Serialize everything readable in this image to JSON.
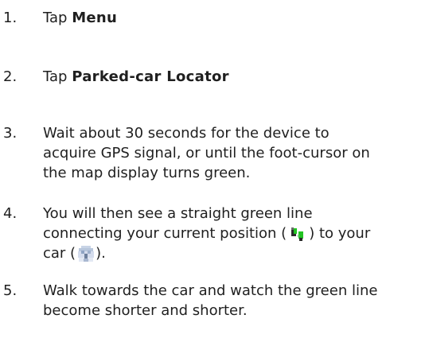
{
  "steps": [
    {
      "number": "1.",
      "prefix": "Tap ",
      "bold": "Menu"
    },
    {
      "number": "2.",
      "prefix": "Tap ",
      "bold": "Parked-car Locator"
    },
    {
      "number": "3.",
      "lines": [
        "Wait about 30 seconds for the device to",
        "acquire GPS signal, or until the foot-cursor on",
        "the map display turns green."
      ]
    },
    {
      "number": "4.",
      "line1": "You will then see a straight green line",
      "line2_a": "connecting your current position (",
      "line2_b": ") to your",
      "line3_a": "car (",
      "line3_b": ")."
    },
    {
      "number": "5.",
      "lines": [
        "Walk towards the car and watch the green line",
        "become shorter and shorter."
      ]
    }
  ],
  "icons": {
    "position": "current-position-icon",
    "car": "car-icon"
  },
  "colors": {
    "text": "#1f1f1f",
    "green": "#22c322",
    "dark": "#222222"
  }
}
